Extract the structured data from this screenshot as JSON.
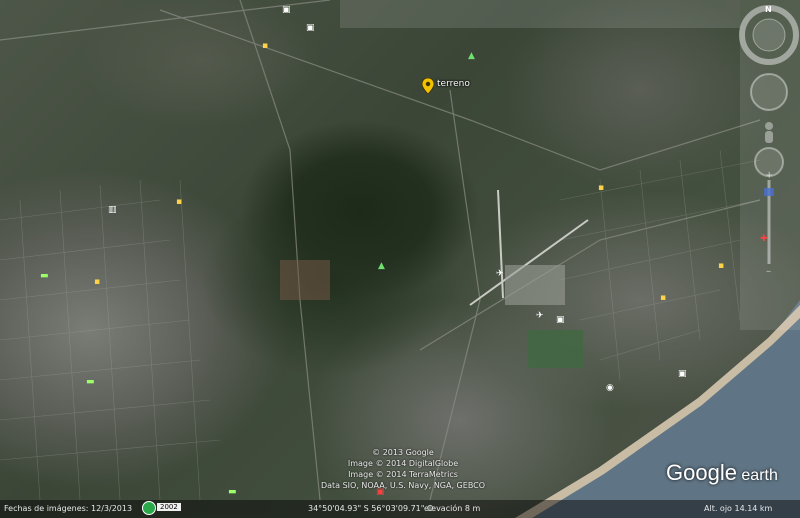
{
  "placemark": {
    "label": "terreno"
  },
  "attribution": {
    "line1": "© 2013 Google",
    "line2": "Image © 2014 DigitalGlobe",
    "line3": "Image © 2014 TerraMetrics",
    "line4": "Data SIO, NOAA, U.S. Navy, NGA, GEBCO"
  },
  "status": {
    "imagery_dates_label": "Fechas de imágenes: 12/3/2013",
    "history_year": "2002",
    "coordinates": "34°50'04.93\" S   56°03'09.71\" O",
    "elevation": "elevación      8 m",
    "eye_alt": "Alt. ojo   14.14 km"
  },
  "logo": {
    "google": "Google",
    "earth": "earth"
  },
  "compass": {
    "north": "N"
  },
  "colors": {
    "placemark": "#f2c100",
    "sea": "#5f7484",
    "beach": "#c9bca5"
  }
}
